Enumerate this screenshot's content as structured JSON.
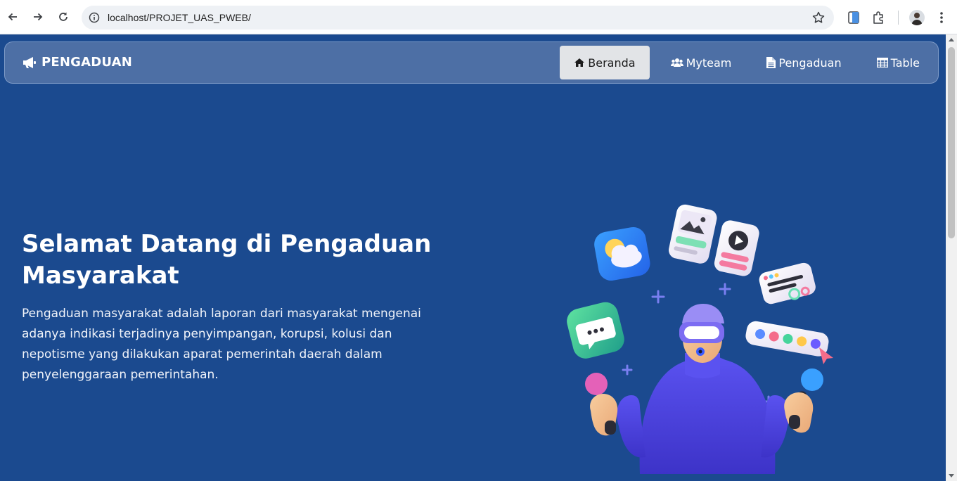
{
  "browser": {
    "url": "localhost/PROJET_UAS_PWEB/",
    "icons": [
      "back-icon",
      "forward-icon",
      "reload-icon",
      "site-info-icon",
      "bookmark-star-icon",
      "reading-mode-icon",
      "extensions-icon",
      "profile-avatar",
      "more-menu-icon"
    ]
  },
  "navbar": {
    "brand": "PENGADUAN",
    "brand_icon": "megaphone-icon",
    "items": [
      {
        "label": "Beranda",
        "icon": "home-icon",
        "active": true
      },
      {
        "label": "Myteam",
        "icon": "users-icon",
        "active": false
      },
      {
        "label": "Pengaduan",
        "icon": "file-icon",
        "active": false
      },
      {
        "label": "Table",
        "icon": "table-icon",
        "active": false
      }
    ]
  },
  "hero": {
    "title": "Selamat Datang di Pengaduan Masyarakat",
    "description": "Pengaduan masyarakat adalah laporan dari masyarakat mengenai adanya indikasi terjadinya penyimpangan, korupsi, kolusi dan nepotisme yang dilakukan aparat pemerintah daerah dalam penyelenggaraan pemerintahan."
  },
  "colors": {
    "background": "#1b4a8f",
    "navbar": "#4d6fa5",
    "active_nav": "#e2e4e7",
    "figure_shirt": "#4f46e5"
  }
}
